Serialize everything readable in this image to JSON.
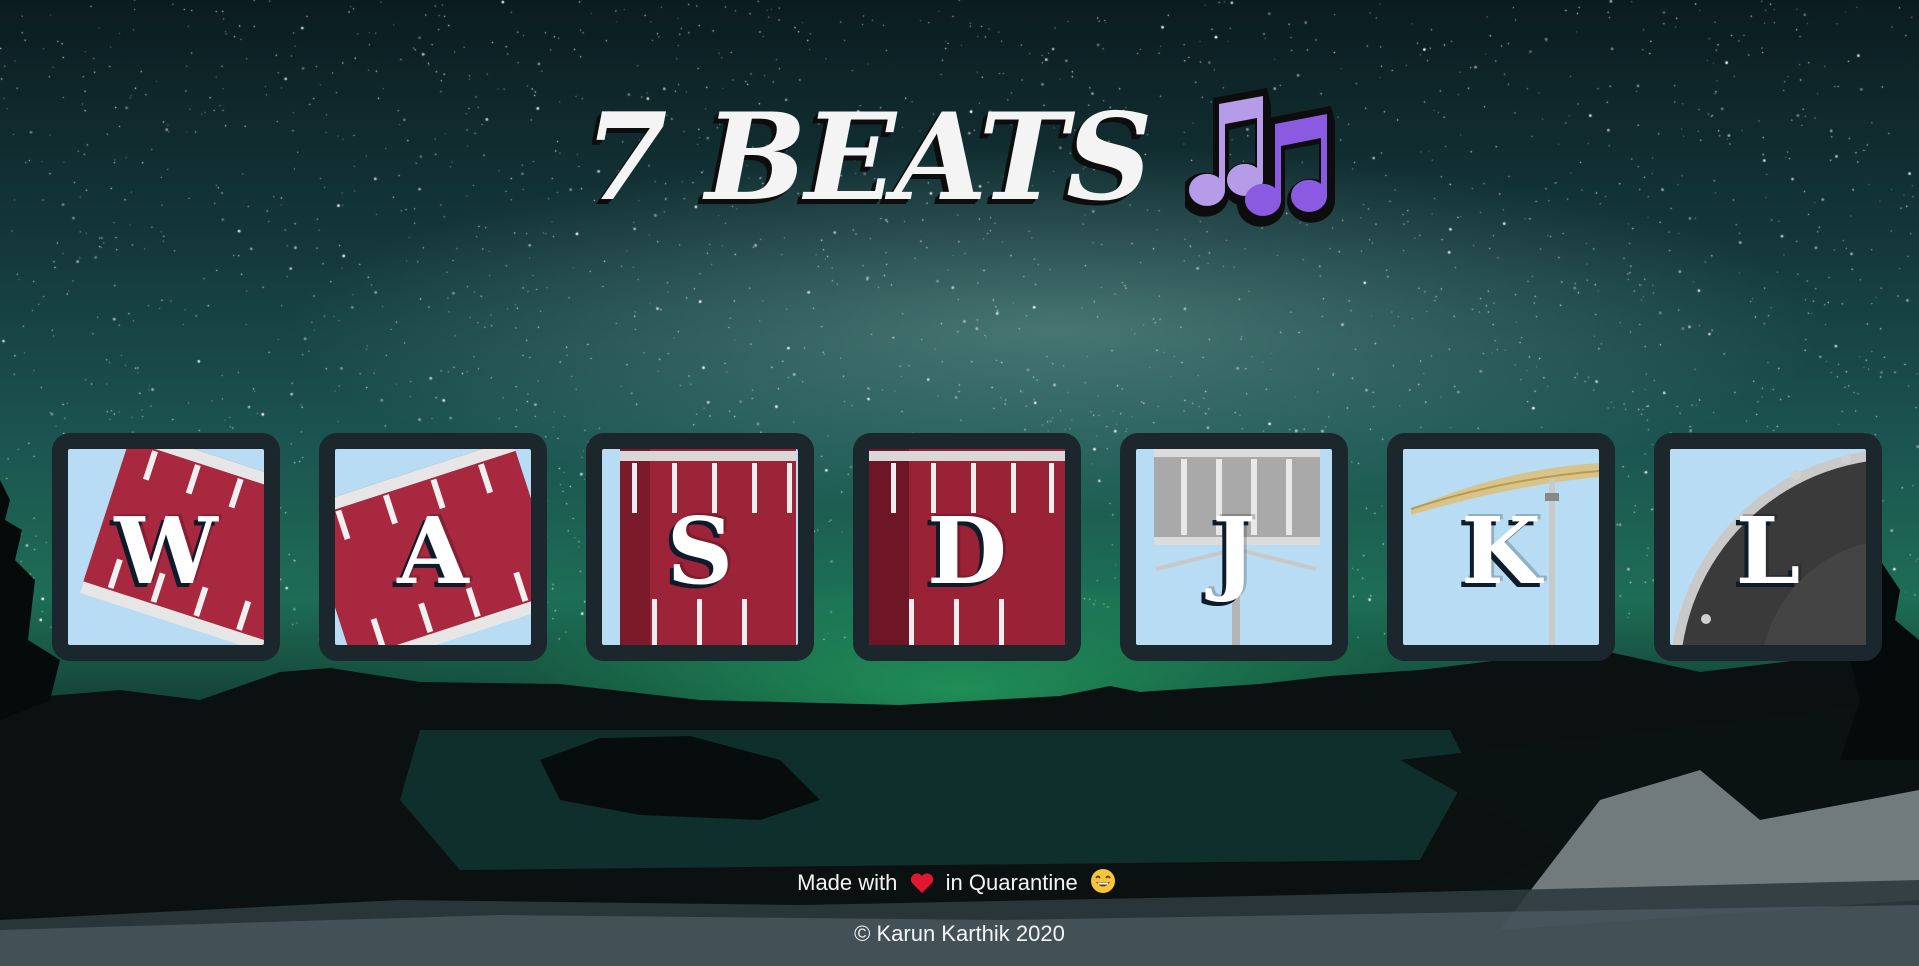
{
  "header": {
    "title": "7 BEATS",
    "icon": "music-notes-icon",
    "icon_color": "#8a5be0"
  },
  "keys": [
    {
      "letter": "W",
      "instrument": "tom-1"
    },
    {
      "letter": "A",
      "instrument": "tom-2"
    },
    {
      "letter": "S",
      "instrument": "tom-3"
    },
    {
      "letter": "D",
      "instrument": "tom-4"
    },
    {
      "letter": "J",
      "instrument": "snare"
    },
    {
      "letter": "K",
      "instrument": "crash"
    },
    {
      "letter": "L",
      "instrument": "kick"
    }
  ],
  "footer": {
    "made_prefix": "Made with",
    "made_suffix": "in Quarantine",
    "heart_icon": "heart-icon",
    "smile_icon": "grinning-face-icon",
    "copyright": "© Karun Karthik 2020"
  },
  "colors": {
    "drum_red": "#a8283f",
    "key_border": "#1c262d",
    "key_bg": "#b8dcf3"
  }
}
